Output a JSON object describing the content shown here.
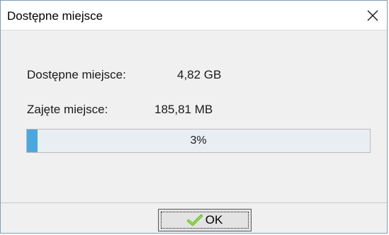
{
  "window": {
    "title": "Dostępne miejsce"
  },
  "info": {
    "available_label": "Dostępne miejsce:",
    "available_value": "4,82 GB",
    "used_label": "Zajęte miejsce:",
    "used_value": "185,81 MB"
  },
  "progress": {
    "text": "3%",
    "percent": 3
  },
  "footer": {
    "ok_label": "OK"
  },
  "colors": {
    "progress_fill": "#4aa8e0",
    "check_icon": "#6cbf2a"
  },
  "icons": {
    "close": "close-icon",
    "ok": "checkmark-icon"
  }
}
